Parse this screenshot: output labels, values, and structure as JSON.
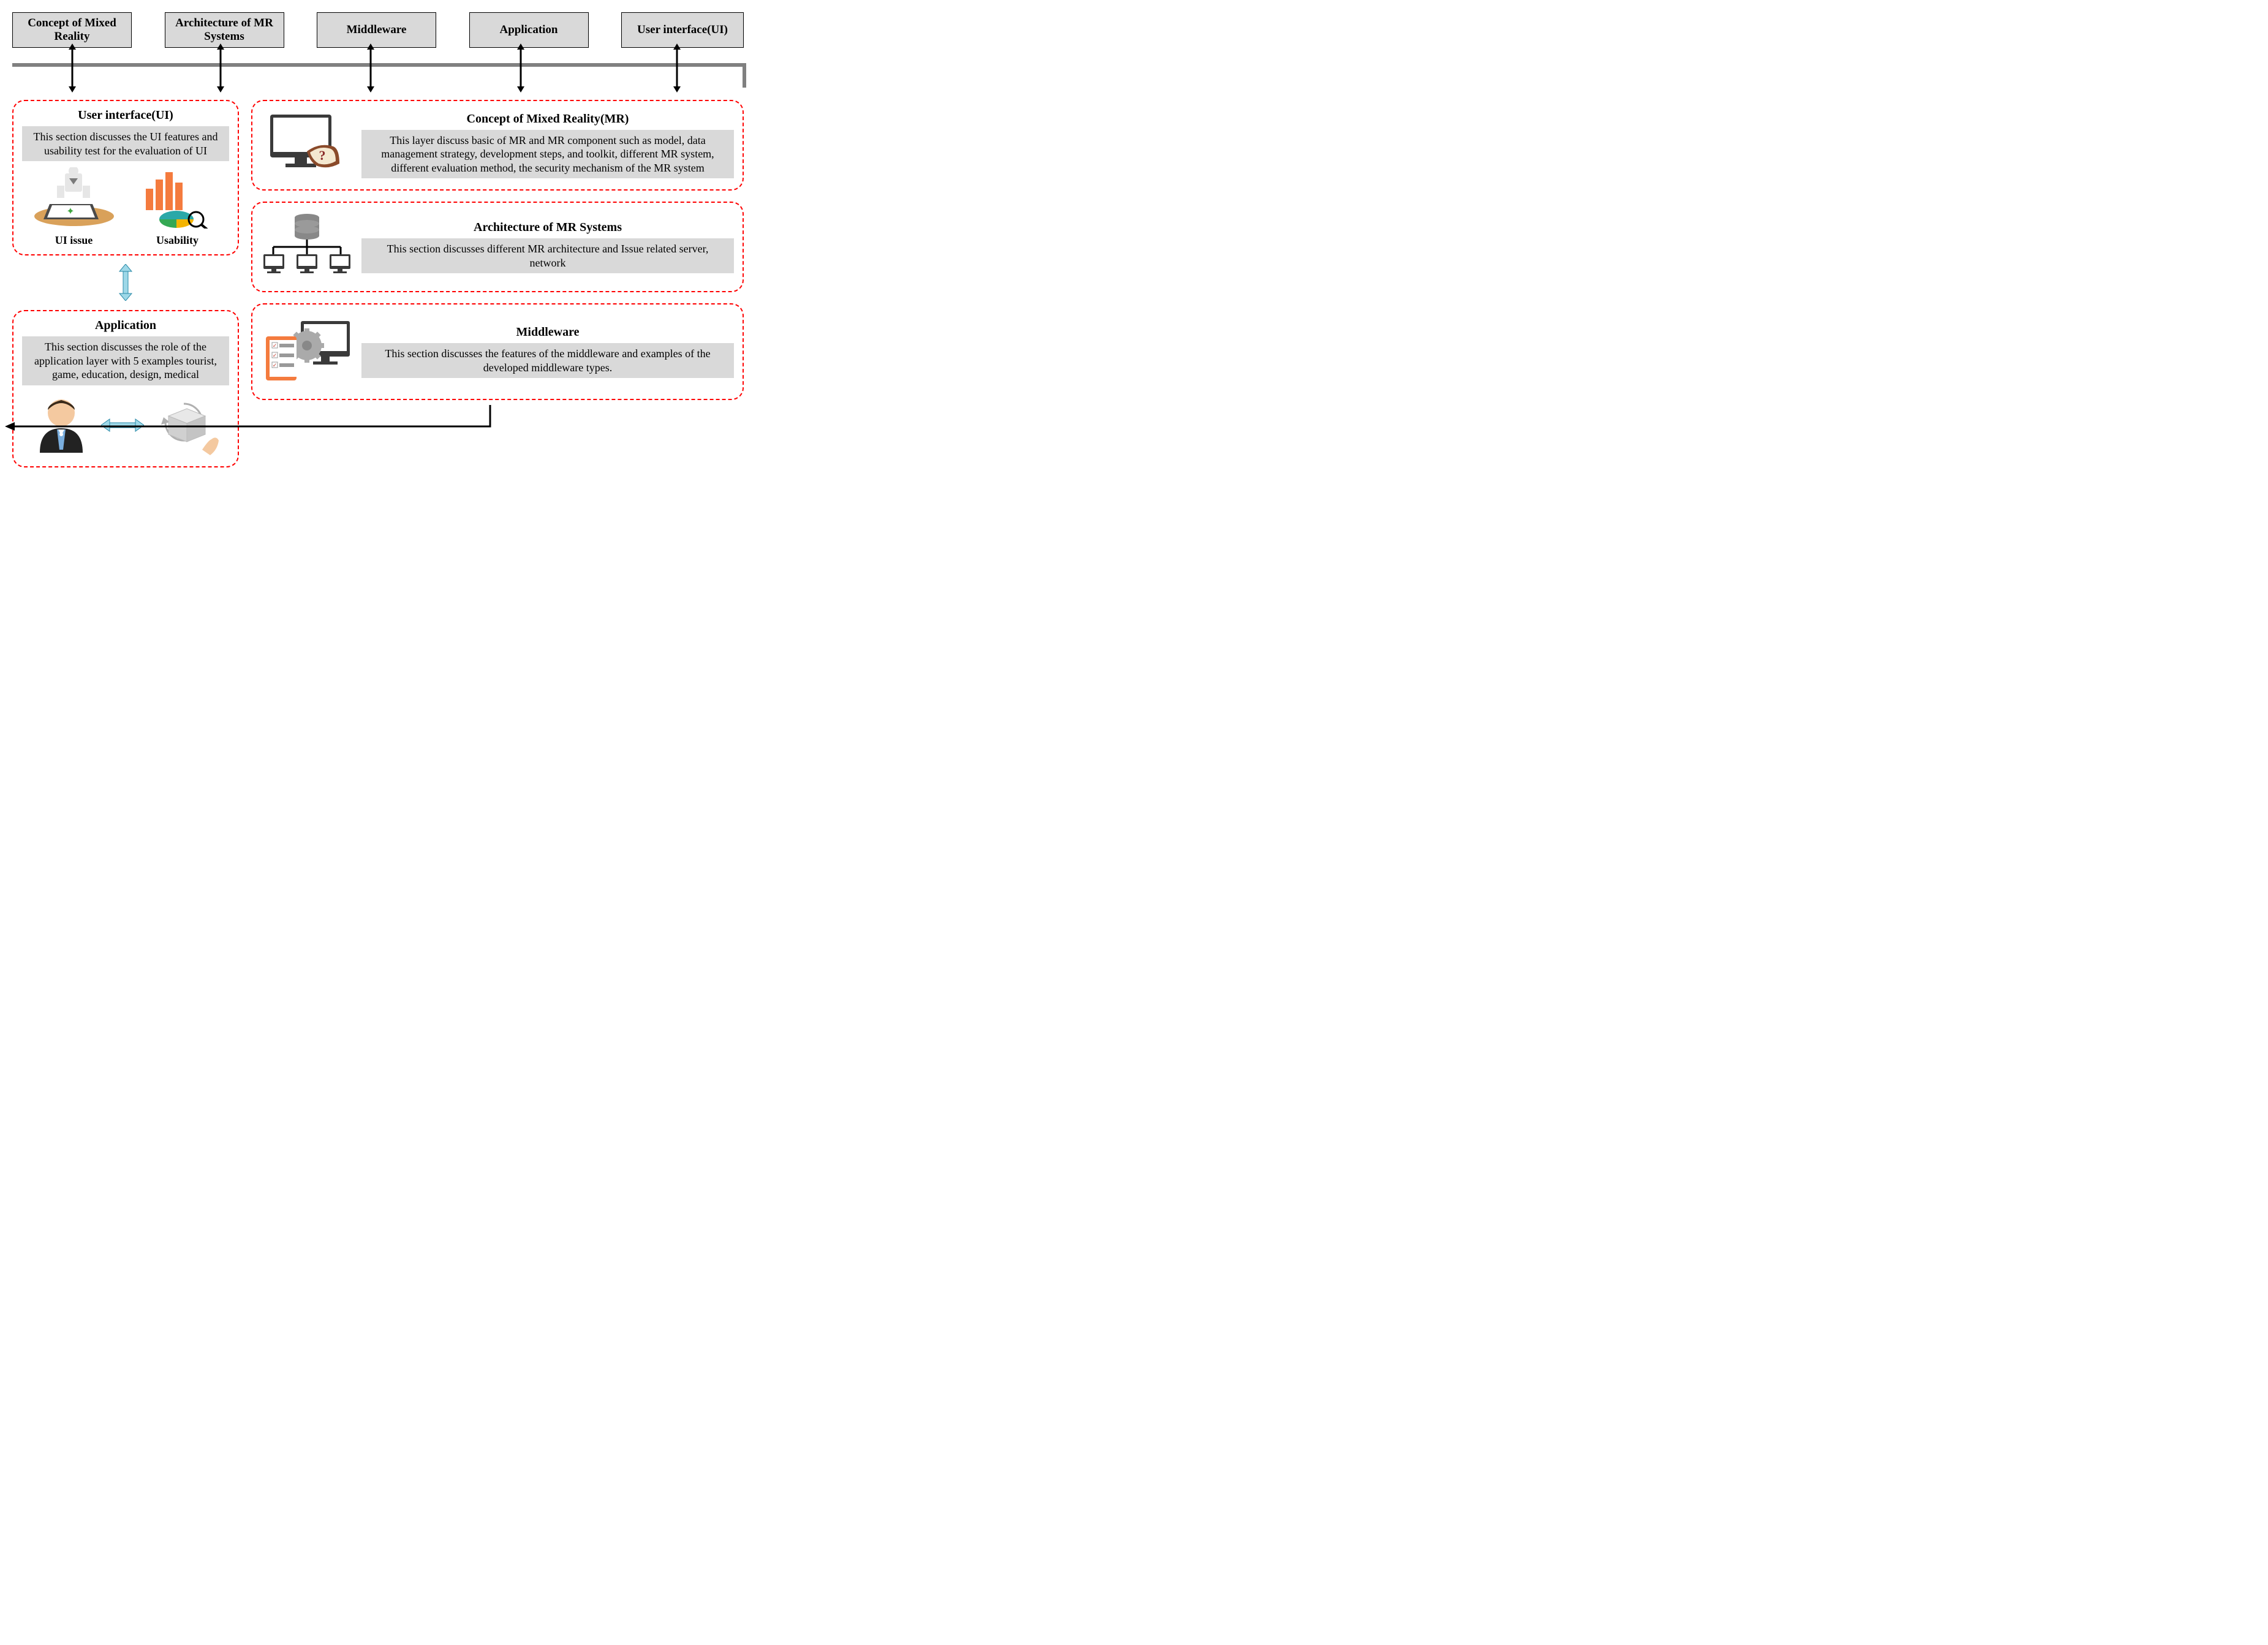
{
  "top": {
    "b1": "Concept of Mixed Reality",
    "b2": "Architecture of MR Systems",
    "b3": "Middleware",
    "b4": "Application",
    "b5": "User interface(UI)"
  },
  "ui": {
    "title": "User interface(UI)",
    "body": "This section discusses the UI features and usability test for the evaluation of UI",
    "label1": "UI issue",
    "label2": "Usability"
  },
  "app": {
    "title": "Application",
    "body": "This section discusses the role of the application layer with 5 examples tourist, game, education, design, medical"
  },
  "concept": {
    "title": "Concept of Mixed Reality(MR)",
    "body": "This layer discuss basic of MR and MR component such as model, data management strategy, development steps, and toolkit, different MR system, different evaluation method, the security mechanism of the MR system"
  },
  "arch": {
    "title": "Architecture of MR Systems",
    "body": "This section discusses different MR architecture and Issue related server, network"
  },
  "mw": {
    "title": "Middleware",
    "body": "This section discusses the features of the middleware and examples of the developed middleware types."
  }
}
